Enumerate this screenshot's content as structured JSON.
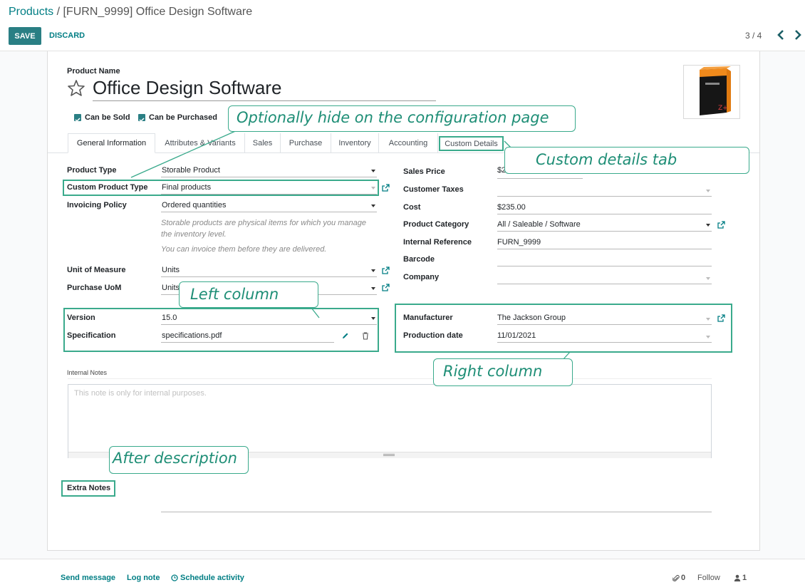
{
  "breadcrumb": {
    "parent": "Products",
    "separator": " / ",
    "current": "[FURN_9999] Office Design Software"
  },
  "buttons": {
    "save": "SAVE",
    "discard": "DISCARD"
  },
  "pager": {
    "value": "3 / 4"
  },
  "product": {
    "name_label": "Product Name",
    "name": "Office Design Software",
    "can_be_sold_label": "Can be Sold",
    "can_be_purchased_label": "Can be Purchased"
  },
  "tabs": [
    "General Information",
    "Attributes & Variants",
    "Sales",
    "Purchase",
    "Inventory",
    "Accounting",
    "Custom Details"
  ],
  "left": {
    "product_type_label": "Product Type",
    "product_type": "Storable Product",
    "custom_type_label": "Custom Product Type",
    "custom_type": "Final products",
    "invoicing_label": "Invoicing Policy",
    "invoicing": "Ordered quantities",
    "note_1": "Storable products are physical items for which you manage the inventory level.",
    "note_2": "You can invoice them before they are delivered.",
    "uom_label": "Unit of Measure",
    "uom": "Units",
    "purchase_uom_label": "Purchase UoM",
    "purchase_uom": "Units",
    "version_label": "Version",
    "version": "15.0",
    "specification_label": "Specification",
    "specification": "specifications.pdf"
  },
  "right": {
    "sales_price_label": "Sales Price",
    "sales_price": "$2",
    "customer_taxes_label": "Customer Taxes",
    "cost_label": "Cost",
    "cost": "$235.00",
    "category_label": "Product Category",
    "category": "All / Saleable / Software",
    "internal_ref_label": "Internal Reference",
    "internal_ref": "FURN_9999",
    "barcode_label": "Barcode",
    "company_label": "Company",
    "manufacturer_label": "Manufacturer",
    "manufacturer": "The Jackson Group",
    "production_date_label": "Production date",
    "production_date": "11/01/2021"
  },
  "internal_notes": {
    "label": "Internal Notes",
    "placeholder": "This note is only for internal purposes."
  },
  "extra_notes": {
    "label": "Extra Notes"
  },
  "callouts": {
    "configuration": "Optionally hide on the configuration page",
    "custom_tab": "Custom details tab",
    "left_column": "Left column",
    "right_column": "Right column",
    "after_description": "After description"
  },
  "chatter": {
    "send_message": "Send message",
    "log_note": "Log note",
    "schedule_activity": "Schedule activity",
    "attachments": "0",
    "follow": "Follow",
    "followers": "1"
  },
  "colors": {
    "accent": "#017e84",
    "save_bg": "#2a7f84",
    "highlight": "#3aaa8c",
    "callout_text": "#1e8e76"
  }
}
